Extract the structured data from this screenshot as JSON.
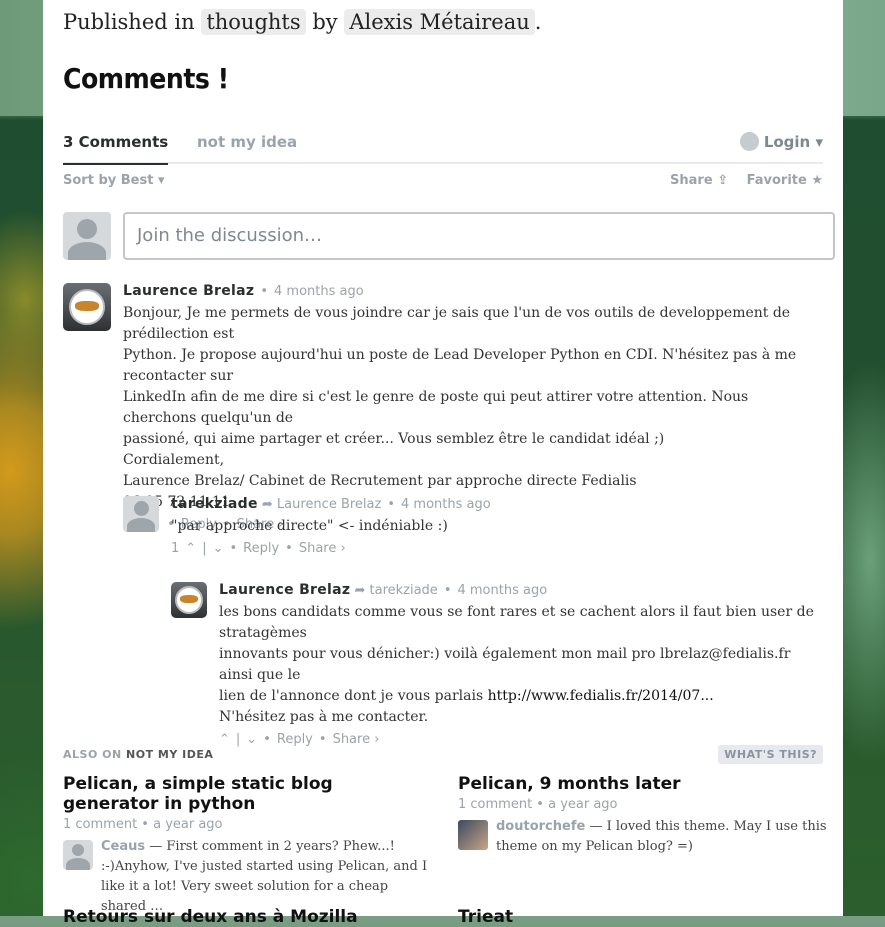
{
  "post": {
    "published_prefix": "Published in",
    "category": "thoughts",
    "by": "by",
    "author": "Alexis Métaireau",
    "end": "."
  },
  "comments_heading": "Comments !",
  "disqus": {
    "tab_count": "3 Comments",
    "tab_site": "not my idea",
    "login": "Login ▾",
    "sort": "Sort by Best ▾",
    "share": "Share ⇪",
    "favorite": "Favorite ★",
    "join_placeholder": "Join the discussion…"
  },
  "comments": [
    {
      "author": "Laurence Brelaz",
      "reply_to": "",
      "time": "4 months ago",
      "lines": [
        "Bonjour, Je me permets de vous joindre car je sais que l'un de vos outils de developpement de prédilection est",
        "Python. Je propose aujourd'hui un poste de Lead Developer Python en CDI. N'hésitez pas à me recontacter sur",
        "LinkedIn afin de me dire si c'est le genre de poste qui peut attirer votre attention. Nous cherchons quelqu'un de",
        "passioné, qui aime partager et créer... Vous semblez être le candidat idéal ;)",
        "Cordialement,",
        "Laurence Brelaz/ Cabinet de Recrutement par approche directe Fedialis",
        "06 95 72 11 11"
      ],
      "votes": "",
      "reply": "Reply",
      "share": "Share ›"
    },
    {
      "author": "tarekziade",
      "reply_to": "➦ Laurence Brelaz",
      "time": "4 months ago",
      "lines": [
        "\"par approche directe\" <- indéniable :)"
      ],
      "votes": "1",
      "reply": "Reply",
      "share": "Share ›"
    },
    {
      "author": "Laurence Brelaz",
      "reply_to": "➦ tarekziade",
      "time": "4 months ago",
      "lines": [
        "les bons candidats comme vous se font rares et se cachent alors il faut bien user de stratagèmes",
        "innovants pour vous dénicher:) voilà également mon mail pro lbrelaz@fedialis.fr ainsi que le",
        "lien de l'annonce dont je vous parlais"
      ],
      "link": "http://www.fedialis.fr/2014/07...",
      "last_line": "N'hésitez pas à me contacter.",
      "votes": "",
      "reply": "Reply",
      "share": "Share ›"
    }
  ],
  "also_on": {
    "label": "ALSO ON",
    "site": "NOT MY IDEA",
    "whats_this": "WHAT'S THIS?",
    "cards": [
      {
        "title": "Pelican, a simple static blog generator in python",
        "meta": "1 comment • a year ago",
        "user": "Ceaus",
        "excerpt": "— First comment in 2 years? Phew...! :-)Anyhow, I've justed started using Pelican, and I like it a lot! Very sweet solution for a cheap shared …"
      },
      {
        "title": "Pelican, 9 months later",
        "meta": "1 comment • a year ago",
        "user": "doutorchefe",
        "excerpt": "— I loved this theme. May I use this theme on my Pelican blog? =)"
      }
    ],
    "cut_titles": [
      "Retours sur deux ans à Mozilla",
      "Trieat"
    ]
  }
}
